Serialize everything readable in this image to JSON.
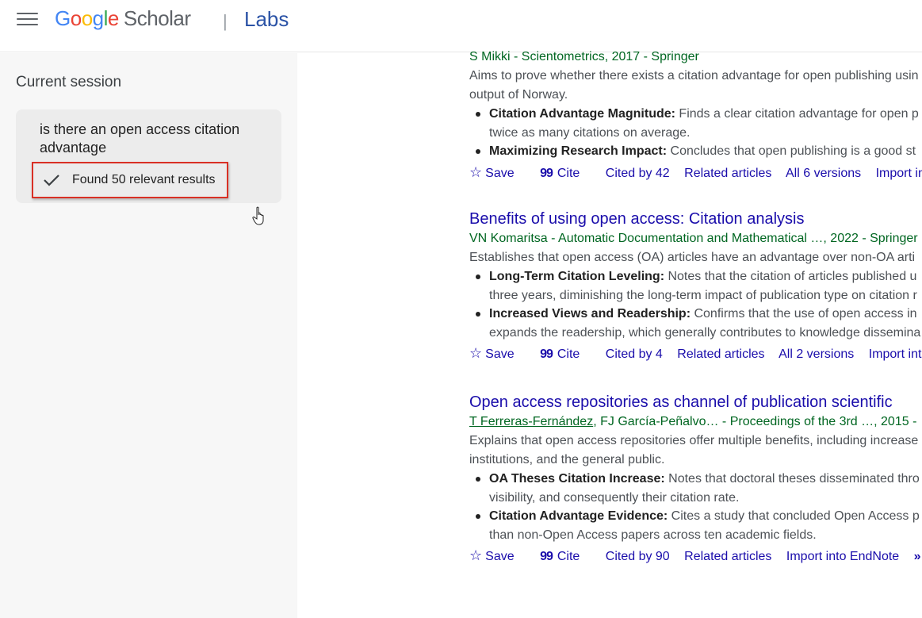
{
  "header": {
    "logo_letters": [
      "G",
      "o",
      "o",
      "g",
      "l",
      "e"
    ],
    "logo_product": "Scholar",
    "separator": "|",
    "labs": "Labs"
  },
  "sidebar": {
    "heading": "Current session",
    "query": "is there an open access citation advantage",
    "status": "Found 50 relevant results"
  },
  "results": [
    {
      "title": "",
      "authors": "S Mikki - Scientometrics, 2017 - Springer",
      "snippet_lines": [
        "Aims to prove whether there exists a citation advantage for open publishing usin",
        "output of Norway."
      ],
      "bullets": [
        {
          "label": "Citation Advantage Magnitude:",
          "lines": [
            " Finds a clear citation advantage for open p",
            "twice as many citations on average."
          ]
        },
        {
          "label": "Maximizing Research Impact:",
          "lines": [
            " Concludes that open publishing is a good st"
          ]
        }
      ],
      "actions": {
        "save": "Save",
        "cite": "Cite",
        "cited_by": "Cited by 42",
        "related": "Related articles",
        "versions": "All 6 versions",
        "import": "Import into E"
      }
    },
    {
      "title": "Benefits of using open access: Citation analysis",
      "authors": "VN Komaritsa - Automatic Documentation and Mathematical …, 2022 - Springer",
      "snippet_lines": [
        "Establishes that open access (OA) articles have an advantage over non-OA arti"
      ],
      "bullets": [
        {
          "label": "Long-Term Citation Leveling:",
          "lines": [
            " Notes that the citation of articles published u",
            "three years, diminishing the long-term impact of publication type on citation r"
          ]
        },
        {
          "label": "Increased Views and Readership:",
          "lines": [
            " Confirms that the use of open access in",
            "expands the readership, which generally contributes to knowledge dissemina"
          ]
        }
      ],
      "actions": {
        "save": "Save",
        "cite": "Cite",
        "cited_by": "Cited by 4",
        "related": "Related articles",
        "versions": "All 2 versions",
        "import": "Import into En"
      }
    },
    {
      "title": "Open access repositories as channel of publication scientific",
      "authors_underlined": "T Ferreras-Fernández",
      "authors_rest": ", FJ García-Peñalvo… - Proceedings of the 3rd …, 2015 -",
      "snippet_lines": [
        "Explains that open access repositories offer multiple benefits, including increase",
        "institutions, and the general public."
      ],
      "bullets": [
        {
          "label": "OA Theses Citation Increase:",
          "lines": [
            " Notes that doctoral theses disseminated thro",
            "visibility, and consequently their citation rate."
          ]
        },
        {
          "label": "Citation Advantage Evidence:",
          "lines": [
            " Cites a study that concluded Open Access p",
            "than non-Open Access papers across ten academic fields."
          ]
        }
      ],
      "actions": {
        "save": "Save",
        "cite": "Cite",
        "cited_by": "Cited by 90",
        "related": "Related articles",
        "import": "Import into EndNote",
        "more": "»"
      }
    }
  ],
  "icons": {
    "menu": "hamburger-icon",
    "check": "check-icon",
    "star": "star-icon",
    "quote": "quote-icon",
    "cursor": "hand-pointer-icon"
  },
  "colors": {
    "link": "#1a0dab",
    "author_green": "#006621",
    "highlight_red": "#d93025"
  }
}
